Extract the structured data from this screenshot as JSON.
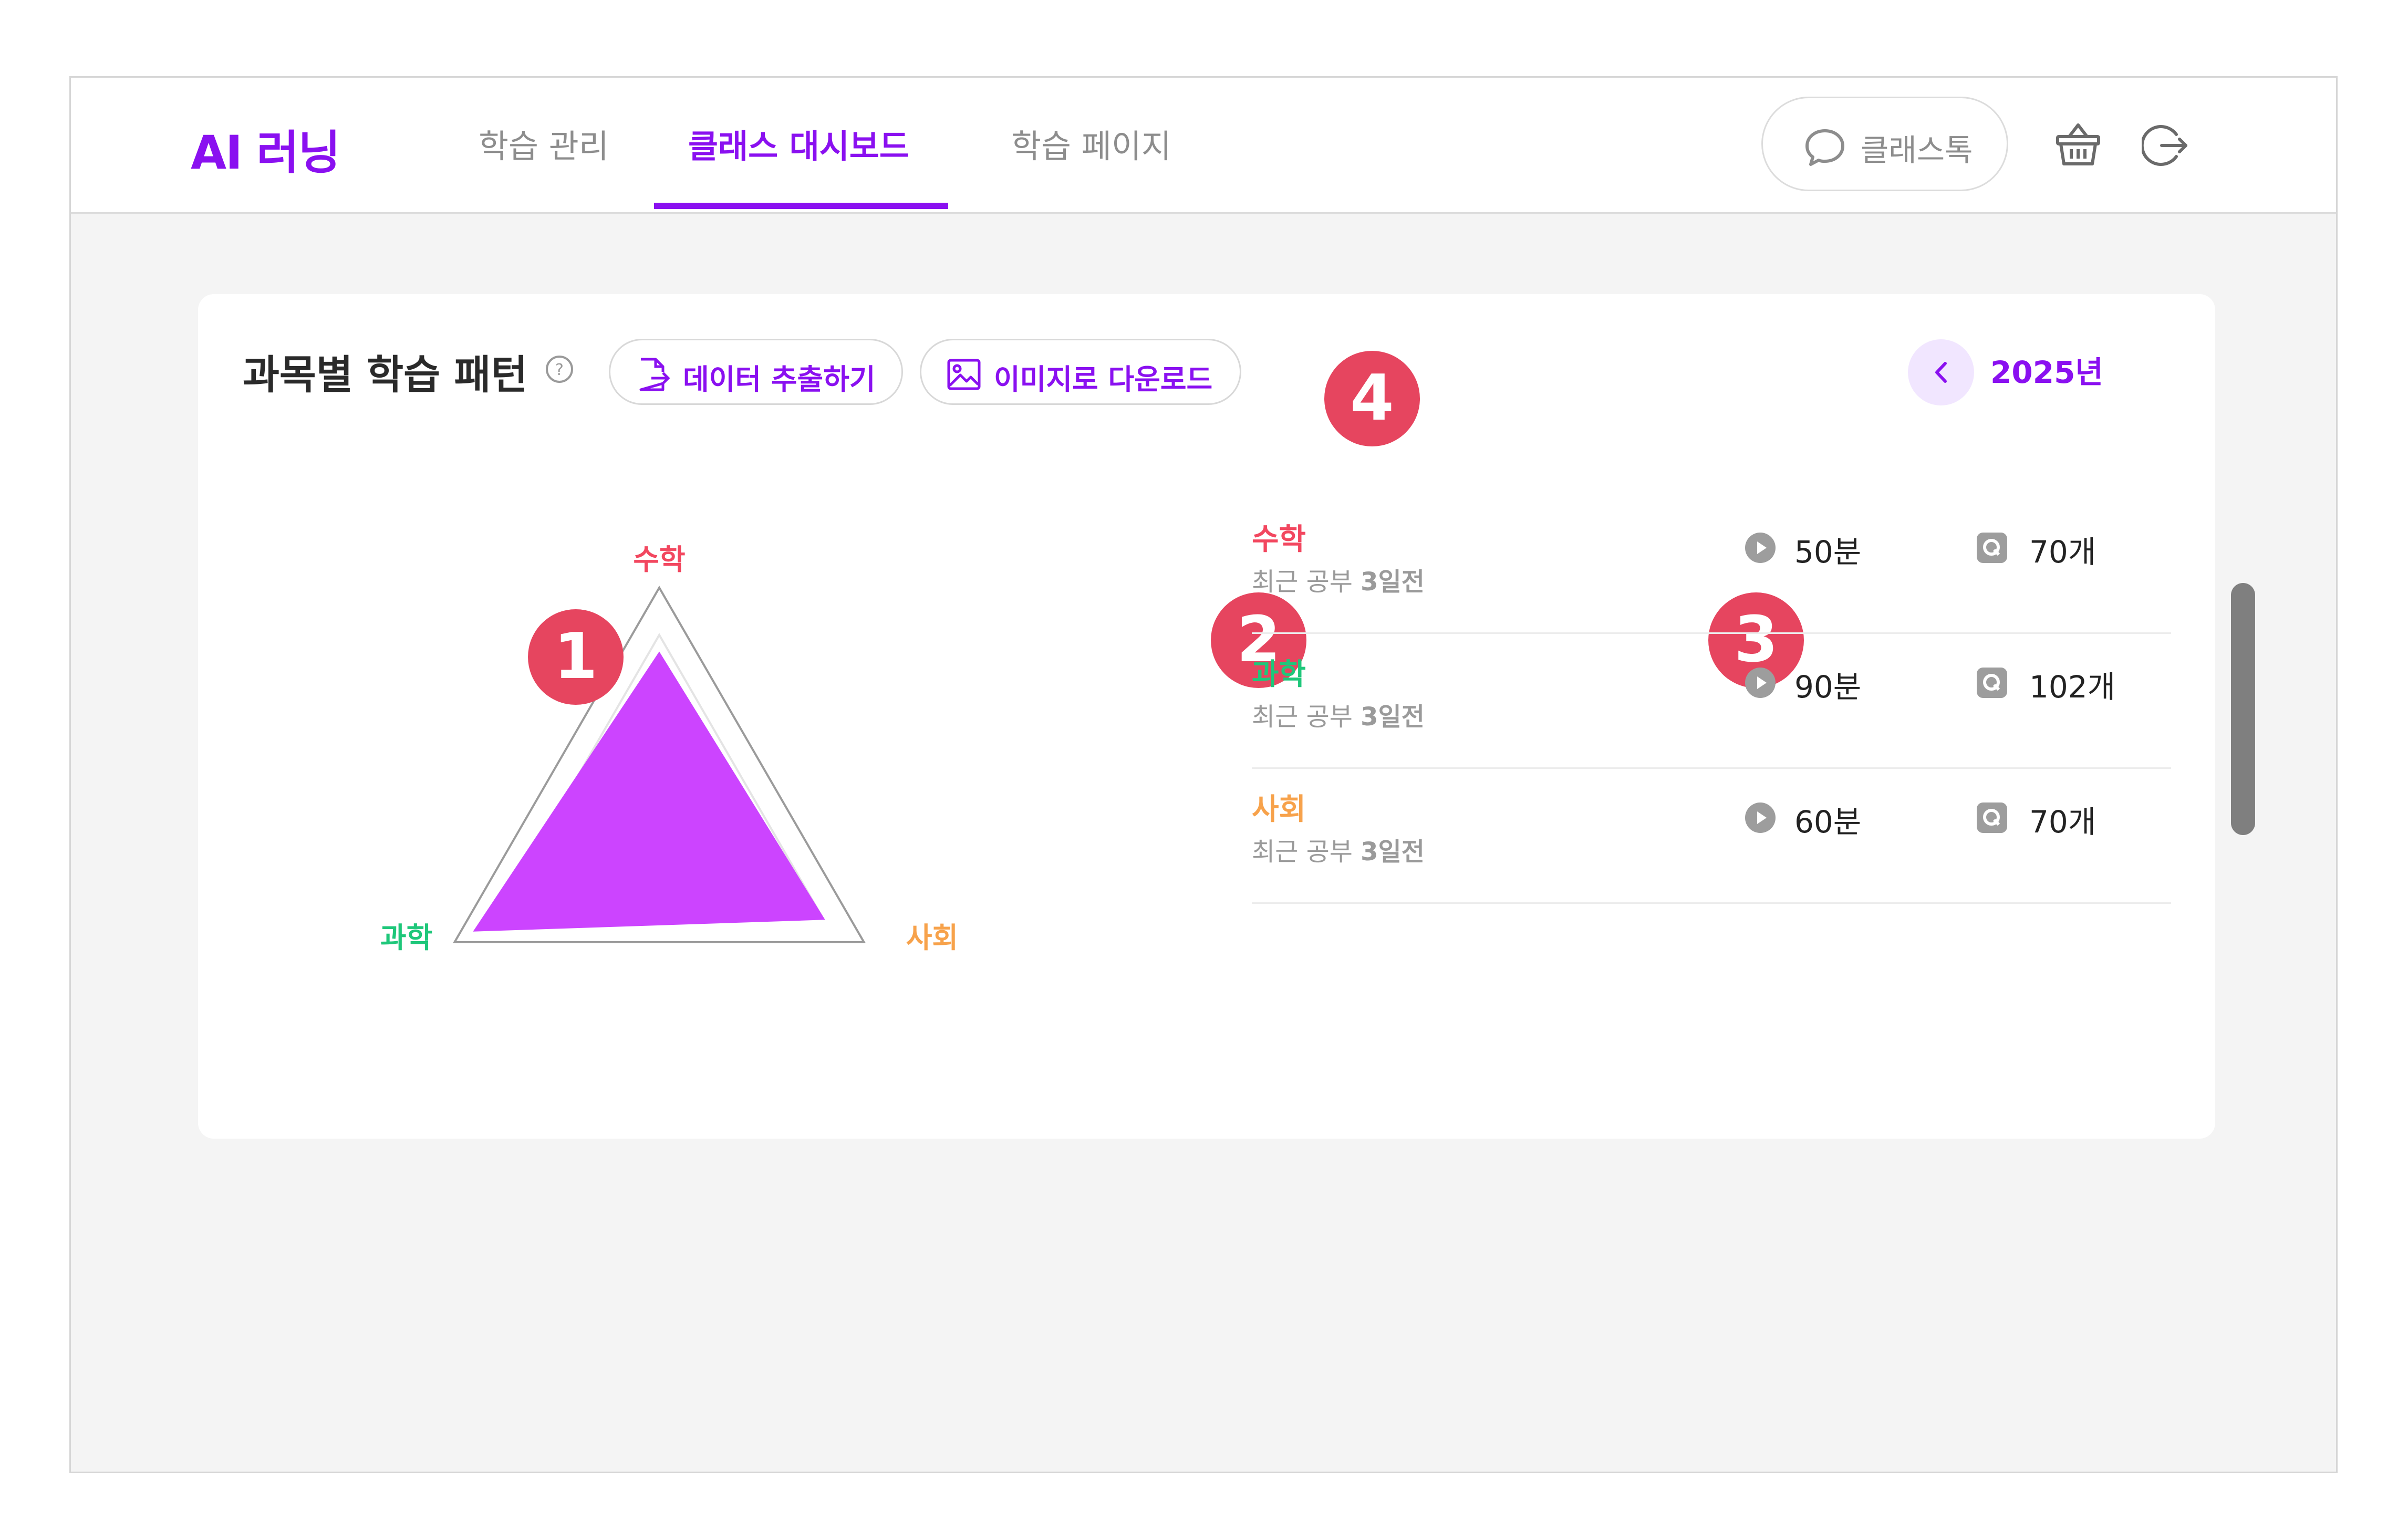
{
  "header": {
    "logo": "AI 러닝",
    "nav": [
      "학습 관리",
      "클래스 대시보드",
      "학습 페이지"
    ],
    "active_nav": "클래스 대시보드",
    "talk_button": "클래스톡"
  },
  "card": {
    "title": "과목별 학습 패턴",
    "export_button": "데이터 추출하기",
    "image_button": "이미지로 다운로드",
    "year": "2025년"
  },
  "markers": [
    "1",
    "2",
    "3",
    "4"
  ],
  "colors": {
    "accent": "#8a10f0",
    "math": "#f2475f",
    "science": "#1ec77a",
    "social": "#f7a24b",
    "radar_fill": "#cc44ff",
    "marker": "#e6455f"
  },
  "chart_data": {
    "type": "radar",
    "axes": [
      "수학",
      "사회",
      "과학"
    ],
    "max": 100,
    "values": [
      73,
      81,
      91
    ]
  },
  "subjects": [
    {
      "name": "수학",
      "recent_prefix": "최근 공부 ",
      "recent_days": "3일전",
      "time": "50분",
      "count": "70개"
    },
    {
      "name": "과학",
      "recent_prefix": "최근 공부 ",
      "recent_days": "3일전",
      "time": "90분",
      "count": "102개"
    },
    {
      "name": "사회",
      "recent_prefix": "최근 공부 ",
      "recent_days": "3일전",
      "time": "60분",
      "count": "70개"
    }
  ]
}
